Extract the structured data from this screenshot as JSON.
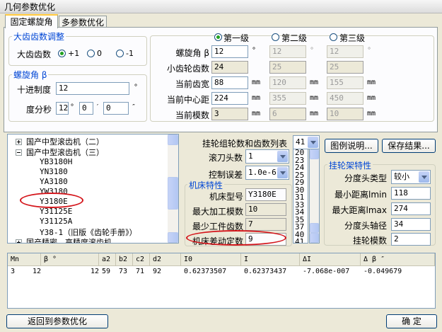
{
  "window": {
    "title": "几何参数优化"
  },
  "tabs": [
    {
      "label": "固定螺旋角"
    },
    {
      "label": "多参数优化"
    }
  ],
  "big_gear": {
    "title": "大齿齿数调整",
    "label": "大齿齿数",
    "options": [
      {
        "label": "+1"
      },
      {
        "label": "0"
      },
      {
        "label": "-1"
      }
    ]
  },
  "helix": {
    "title": "螺旋角 β",
    "decimal_label": "十进制度",
    "decimal_value": "12",
    "decimal_unit": "°",
    "dms_label": "度分秒",
    "deg": "12",
    "deg_unit": "°",
    "min": "0",
    "min_unit": "′",
    "sec": "0",
    "sec_unit": "″"
  },
  "levels": {
    "headers": [
      {
        "label": "第一级"
      },
      {
        "label": "第二级"
      },
      {
        "label": "第三级"
      }
    ],
    "rows": [
      {
        "label": "螺旋角 β",
        "values": [
          "12",
          "12",
          "12"
        ],
        "unit": "°"
      },
      {
        "label": "小齿轮齿数",
        "values": [
          "24",
          "25",
          "25"
        ],
        "unit": ""
      },
      {
        "label": "当前齿宽",
        "values": [
          "88",
          "120",
          "155"
        ],
        "unit": "mm"
      },
      {
        "label": "当前中心距",
        "values": [
          "224",
          "355",
          "450"
        ],
        "unit": "mm"
      },
      {
        "label": "当前模数",
        "values": [
          "3",
          "6",
          "10"
        ],
        "unit": "mm"
      }
    ]
  },
  "tree": {
    "items": [
      {
        "text": "国产中型滚齿机（二）"
      },
      {
        "text": "国产中型滚齿机（三）"
      },
      {
        "text": "YB3180H"
      },
      {
        "text": "YN3180"
      },
      {
        "text": "YA3180"
      },
      {
        "text": "YW3180"
      },
      {
        "text": "Y3180E"
      },
      {
        "text": "Y31125E"
      },
      {
        "text": "Y31125A"
      },
      {
        "text": "Y38-1（旧版《齿轮手册》）"
      },
      {
        "text": "国产精密、高精度滚齿机"
      }
    ]
  },
  "params": {
    "gear_list_label": "挂轮组轮数和齿数列表",
    "gear_list_value": "41",
    "hob_heads_label": "滚刀头数",
    "hob_heads_value": "1",
    "tolerance_label": "控制误差",
    "tolerance_value": "1.0e-6",
    "list_items": [
      "20",
      "23",
      "24",
      "25",
      "29",
      "30",
      "31",
      "33",
      "34",
      "35",
      "37",
      "40",
      "41"
    ]
  },
  "machine": {
    "title": "机床特性",
    "rows": [
      {
        "label": "机床型号",
        "value": "Y3180E"
      },
      {
        "label": "最大加工模数",
        "value": "10"
      },
      {
        "label": "最少工件齿数",
        "value": "7"
      },
      {
        "label": "机床差动定数",
        "value": "9"
      }
    ]
  },
  "buttons": {
    "legend": "图例说明...",
    "save": "保存结果...",
    "back": "返回到参数优化",
    "ok": "确  定"
  },
  "hanger": {
    "title": "挂轮架特性",
    "head_type_label": "分度头类型",
    "head_type_value": "较小",
    "min_dist_label": "最小距离lmin",
    "min_dist_value": "118",
    "max_dist_label": "最大距离lmax",
    "max_dist_value": "274",
    "head_shaft_label": "分度头轴径",
    "head_shaft_value": "34",
    "module_label": "挂轮模数",
    "module_value": "2"
  },
  "results": {
    "columns": [
      "Mn",
      "β °",
      "a2",
      "b2",
      "c2",
      "d2",
      "I0",
      "I",
      "ΔI",
      "Δ β ″"
    ],
    "rows": [
      [
        "3",
        "12",
        "12",
        "59",
        "73",
        "71",
        "92",
        "0.62373507",
        "0.62373437",
        "-7.068e-007",
        "-0.049679"
      ]
    ]
  },
  "colors": {
    "accent": "#0046d5",
    "highlight": "#d4141a"
  }
}
